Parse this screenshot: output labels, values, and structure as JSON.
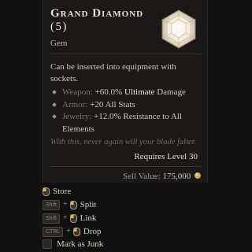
{
  "item": {
    "name": "Grand Diamond",
    "quantity": "(5)",
    "type": "Gem",
    "description": "Can be inserted into equipment with sockets.",
    "weapon": {
      "slot": "Weapon:",
      "value_prefix": "+60.0%",
      "value_strong": "Ultimate",
      "value_suffix": "Damage"
    },
    "armor": {
      "slot": "Armor:",
      "value": "+20 All Stats"
    },
    "jewelry": {
      "slot": "Jewelry:",
      "value": "+12.0% Resistance to All Elements"
    },
    "flavor": "With this, never again will your blade falter.",
    "requirement": "Requires Level 30",
    "sell_label": "Sell Value:",
    "sell_value": "175,000",
    "icon": "diamond-gem-icon"
  },
  "actions": {
    "store": {
      "label": "Store",
      "icon": "mouse-icon"
    },
    "split": {
      "key": "Shift",
      "label": "Split",
      "icon": "mouse-icon"
    },
    "link": {
      "key": "Shift",
      "label": "Link",
      "icon": "mouse-icon"
    },
    "drop": {
      "key": "CTRL",
      "label": "Drop",
      "icon": "mouse-icon"
    },
    "junk": {
      "label": "Mark as Junk"
    }
  }
}
